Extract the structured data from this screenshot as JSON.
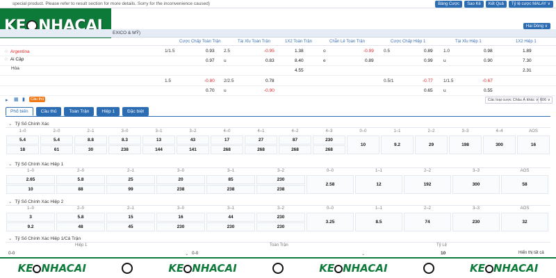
{
  "topbar": {
    "notice": "special product. Please refer to result section for more details. Sorry for the inconvenience caused)",
    "buttons": [
      "Bảng Cược",
      "Sao Kê",
      "Kết Quả",
      "Tỷ lệ cược MALAY ∨"
    ]
  },
  "logo": {
    "left": "KE",
    "right": "NHACAI"
  },
  "lang": "Hai Dòng ∨",
  "match": {
    "title": "EXICO & MỸ)"
  },
  "headers": [
    "Cược Chấp Toàn Trận",
    "Tài Xỉu Toàn Trận",
    "1X2 Toàn Trận",
    "Chẵn Lẻ Toàn Trận",
    "Cược Chấp Hiệp 1",
    "Tài Xỉu Hiệp 1",
    "1X2 Hiệp 1"
  ],
  "teams": {
    "home": "Argentina",
    "away": "Ai Cập",
    "draw": "Hòa"
  },
  "odds_row1": {
    "hcp": "1/1.5",
    "hcp_home": "0.93",
    "ou": "2.5",
    "ou_o": "-0.95",
    "x12": "1.38",
    "oe_o_lbl": "o",
    "oe_o": "-0.99",
    "h1hcp": "0.5",
    "h1hcp_h": "0.89",
    "h1ou": "1.0",
    "h1ou_o": "0.98",
    "h1x12": "1.89"
  },
  "odds_row2": {
    "hcp_away": "0.97",
    "ou_u_lbl": "u",
    "ou_u": "0.83",
    "x12": "8.40",
    "oe_e_lbl": "e",
    "oe_e": "0.89",
    "h1hcp_a": "0.99",
    "h1ou_u_lbl": "u",
    "h1ou_u": "0.90",
    "h1x12": "7.30"
  },
  "odds_row3": {
    "x12": "4.55",
    "h1x12": "2.31"
  },
  "odds_row4": {
    "hcp": "1.5",
    "hcp_home": "-0.80",
    "ou": "2/2.5",
    "ou_o": "0.78",
    "h1hcp": "0.5/1",
    "h1hcp_h": "-0.77",
    "h1ou": "1/1.5",
    "h1ou_o": "-0.67"
  },
  "odds_row5": {
    "hcp_away": "0.70",
    "ou_u_lbl": "u",
    "ou_u": "-0.90",
    "h1hcp_a": "0.65",
    "h1ou_u_lbl": "u",
    "h1ou_u": "0.55"
  },
  "tool": {
    "badge": "Cầu thủ",
    "sort": "Các loại cược Châu Á khác ∨",
    "count": "606 ∨"
  },
  "tabs": [
    "Phổ biến",
    "Cầu thủ",
    "Toàn Trận",
    "Hiệp 1",
    "Đặc biệt"
  ],
  "sections": {
    "s1": {
      "title": "Tỷ Số Chính Xác",
      "labels": [
        "1–0",
        "2–0",
        "2–1",
        "3–0",
        "3–1",
        "3–2",
        "4–0",
        "4–1",
        "4–2",
        "4–3",
        "0–0",
        "1–1",
        "2–2",
        "3–3",
        "4–4",
        "AOS"
      ],
      "row1": [
        "5.4",
        "5.4",
        "8.8",
        "8.3",
        "13",
        "43",
        "17",
        "27",
        "87",
        "230"
      ],
      "row2": [
        "18",
        "61",
        "30",
        "238",
        "144",
        "141",
        "268",
        "268",
        "268",
        "268"
      ],
      "mid": [
        "10",
        "9.2",
        "29",
        "198",
        "300",
        "16"
      ]
    },
    "s2": {
      "title": "Tỷ Số Chính Xác Hiệp 1",
      "labels": [
        "1–0",
        "2–0",
        "2–1",
        "3–0",
        "3–1",
        "3–2",
        "0–0",
        "1–1",
        "2–2",
        "3–3",
        "AOS"
      ],
      "row1": [
        "2.65",
        "5.8",
        "25",
        "20",
        "85",
        "230"
      ],
      "row2": [
        "10",
        "88",
        "99",
        "238",
        "238",
        "238"
      ],
      "mid": [
        "2.58",
        "12",
        "192",
        "300",
        "58"
      ]
    },
    "s3": {
      "title": "Tỷ Số Chính Xác Hiệp 2",
      "labels": [
        "1–0",
        "2–0",
        "2–1",
        "3–0",
        "3–1",
        "3–2",
        "0–0",
        "1–1",
        "2–2",
        "3–3",
        "AOS"
      ],
      "row1": [
        "3",
        "5.8",
        "15",
        "16",
        "44",
        "230"
      ],
      "row2": [
        "9.2",
        "48",
        "45",
        "230",
        "230",
        "230"
      ],
      "mid": [
        "3.25",
        "8.5",
        "74",
        "230",
        "32"
      ]
    },
    "s4": {
      "title": "Tỷ Số Chính Xác Hiệp 1/Cả Trận",
      "cols": [
        "Hiệp 1",
        "Toàn Trận",
        "Tỷ Lệ"
      ],
      "v1": "0-0",
      "v2": "0-0",
      "v3": "10",
      "show": "Hiển thị tất cả"
    }
  },
  "footer": {
    "left": "KE",
    "right": "NHACAI"
  }
}
